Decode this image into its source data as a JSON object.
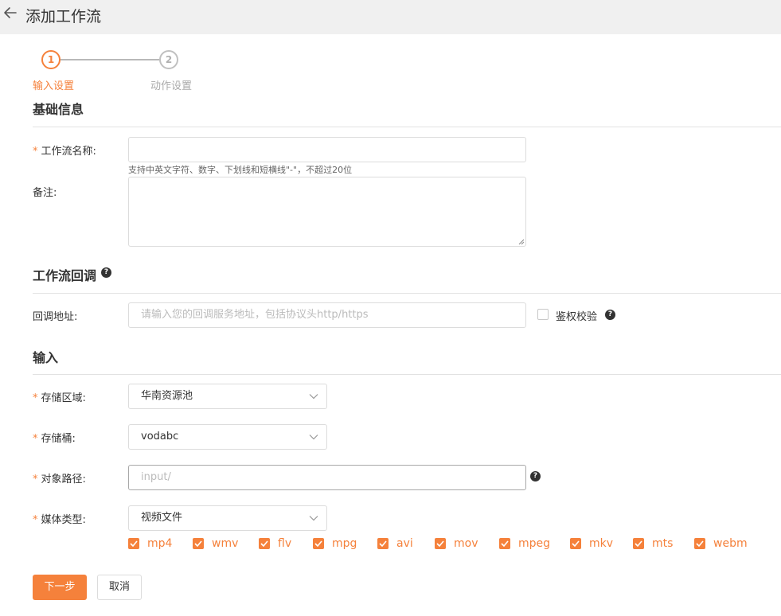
{
  "header": {
    "title": "添加工作流"
  },
  "steps": [
    {
      "number": "1",
      "label": "输入设置"
    },
    {
      "number": "2",
      "label": "动作设置"
    }
  ],
  "basic": {
    "title": "基础信息",
    "name_label": "工作流名称:",
    "name_value": "",
    "name_hint": "支持中英文字符、数字、下划线和短横线\"-\"，不超过20位",
    "remark_label": "备注:",
    "remark_value": ""
  },
  "callback": {
    "title": "工作流回调",
    "url_label": "回调地址:",
    "url_placeholder": "请输入您的回调服务地址，包括协议头http/https",
    "auth_label": "鉴权校验",
    "auth_checked": false
  },
  "input": {
    "title": "输入",
    "region_label": "存储区域:",
    "region_value": "华南资源池",
    "bucket_label": "存储桶:",
    "bucket_value": "vodabc",
    "path_label": "对象路径:",
    "path_placeholder": "input/",
    "media_label": "媒体类型:",
    "media_value": "视频文件",
    "media_types": [
      {
        "label": "mp4",
        "checked": true
      },
      {
        "label": "wmv",
        "checked": true
      },
      {
        "label": "flv",
        "checked": true
      },
      {
        "label": "mpg",
        "checked": true
      },
      {
        "label": "avi",
        "checked": true
      },
      {
        "label": "mov",
        "checked": true
      },
      {
        "label": "mpeg",
        "checked": true
      },
      {
        "label": "mkv",
        "checked": true
      },
      {
        "label": "mts",
        "checked": true
      },
      {
        "label": "webm",
        "checked": true
      }
    ]
  },
  "required_mark": "*",
  "help_glyph": "?",
  "actions": {
    "next": "下一步",
    "cancel": "取消"
  },
  "colors": {
    "accent": "#f5813b",
    "text": "#333333",
    "muted": "#aaaaaa",
    "border": "#dcdcdc"
  },
  "icons": {
    "back": "arrow-left-icon",
    "help": "question-circle-icon",
    "dropdown": "chevron-down-icon",
    "check": "check-icon"
  }
}
